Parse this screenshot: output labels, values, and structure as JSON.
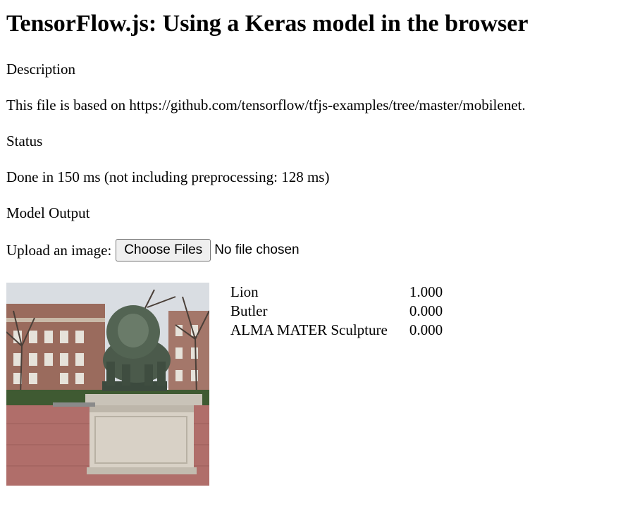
{
  "title": "TensorFlow.js: Using a Keras model in the browser",
  "description_heading": "Description",
  "description_text": "This file is based on https://github.com/tensorflow/tfjs-examples/tree/master/mobilenet.",
  "status_heading": "Status",
  "status_text": "Done in 150 ms (not including preprocessing: 128 ms)",
  "output_heading": "Model Output",
  "upload": {
    "label": "Upload an image:",
    "button_label": "Choose Files",
    "file_status": "No file chosen"
  },
  "image": {
    "subject": "lion-statue-photo"
  },
  "predictions": [
    {
      "label": "Lion",
      "probability": "1.000"
    },
    {
      "label": "Butler",
      "probability": "0.000"
    },
    {
      "label": "ALMA MATER Sculpture",
      "probability": "0.000"
    }
  ]
}
